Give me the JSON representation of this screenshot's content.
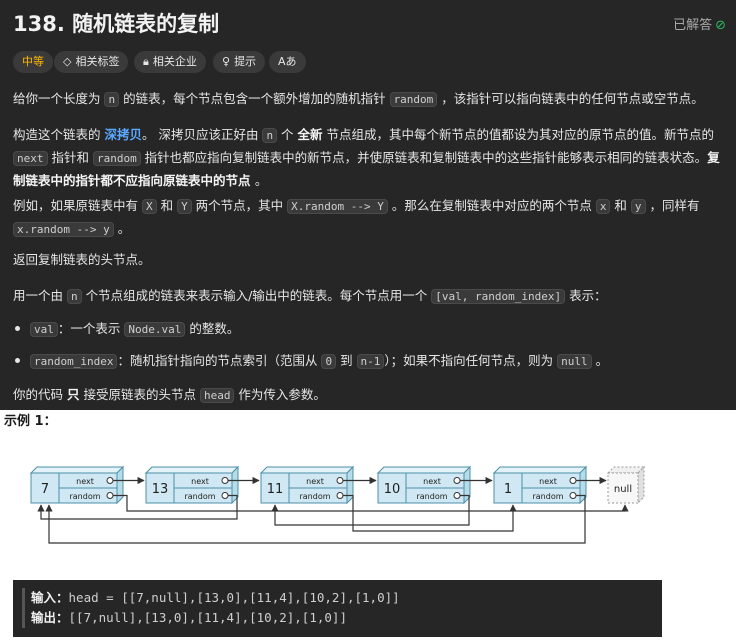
{
  "header": {
    "title": "138. 随机链表的复制",
    "solved": "已解答"
  },
  "tags": {
    "difficulty": "中等",
    "related_tags": "相关标签",
    "companies": "相关企业",
    "hint": "提示",
    "font_toggle": "Aあ"
  },
  "desc": {
    "p1": {
      "a": "给你一个长度为 ",
      "c1": "n",
      "b": " 的链表，每个节点包含一个额外增加的随机指针 ",
      "c2": "random",
      "c": " ，该指针可以指向链表中的任何节点或空节点。"
    },
    "p2": {
      "a": "构造这个链表的 ",
      "link": "深拷贝",
      "b": "。 深拷贝应该正好由 ",
      "c1": "n",
      "c": " 个 ",
      "strong1": "全新",
      "d": " 节点组成，其中每个新节点的值都设为其对应的原节点的值。新节点的 ",
      "c2": "next",
      "e": " 指针和 ",
      "c3": "random",
      "f": " 指针也都应指向复制链表中的新节点，并使原链表和复制链表中的这些指针能够表示相同的链表状态。",
      "strong2": "复制链表中的指针都不应指向原链表中的节点 ",
      "g": "。"
    },
    "p3": {
      "a": "例如，如果原链表中有 ",
      "c1": "X",
      "b": " 和 ",
      "c2": "Y",
      "c": " 两个节点，其中 ",
      "c3": "X.random --> Y",
      "d": " 。那么在复制链表中对应的两个节点 ",
      "c4": "x",
      "e": " 和 ",
      "c5": "y",
      "f": " ，同样有 ",
      "c6": "x.random --> y",
      "g": " 。"
    },
    "p4": "返回复制链表的头节点。",
    "p5": {
      "a": "用一个由 ",
      "c1": "n",
      "b": " 个节点组成的链表来表示输入/输出中的链表。每个节点用一个 ",
      "c2": "[val, random_index]",
      "c": " 表示："
    },
    "b1": {
      "c1": "val",
      "a": "：一个表示 ",
      "c2": "Node.val",
      "b": " 的整数。"
    },
    "b2": {
      "c1": "random_index",
      "a": "：随机指针指向的节点索引（范围从 ",
      "c2": "0",
      "b": " 到 ",
      "c3": "n-1",
      "c": "）；如果不指向任何节点，则为 ",
      "c4": "null",
      "d": " 。"
    },
    "p6": {
      "a": "你的代码 ",
      "strong": "只",
      "b": " 接受原链表的头节点 ",
      "c1": "head",
      "c": " 作为传入参数。"
    }
  },
  "example": {
    "title": "示例 1：",
    "input_label": "输入：",
    "input_value": "head = [[7,null],[13,0],[11,4],[10,2],[1,0]]",
    "output_label": "输出：",
    "output_value": "[[7,null],[13,0],[11,4],[10,2],[1,0]]"
  },
  "diagram": {
    "nodes": [
      "7",
      "13",
      "11",
      "10",
      "1"
    ],
    "next_label": "next",
    "random_label": "random",
    "null_label": "null",
    "random_targets": [
      null,
      0,
      4,
      2,
      0
    ]
  },
  "colors": {
    "accent": "#ffb800",
    "link": "#5aa8ff",
    "solved_check": "#2cbb5d",
    "node_fill": "#cfe8f3",
    "node_stroke": "#4c8fa8"
  }
}
